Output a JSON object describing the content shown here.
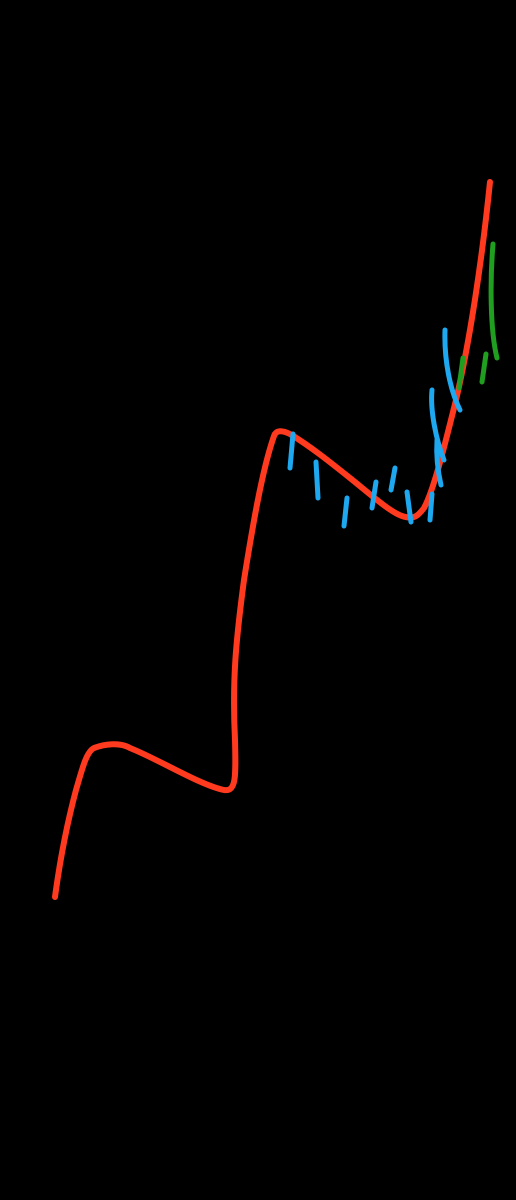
{
  "canvas": {
    "background": "#000000"
  },
  "colors": {
    "red": "#ff3a1f",
    "blue": "#1ea8f0",
    "green": "#1f9e1f"
  }
}
